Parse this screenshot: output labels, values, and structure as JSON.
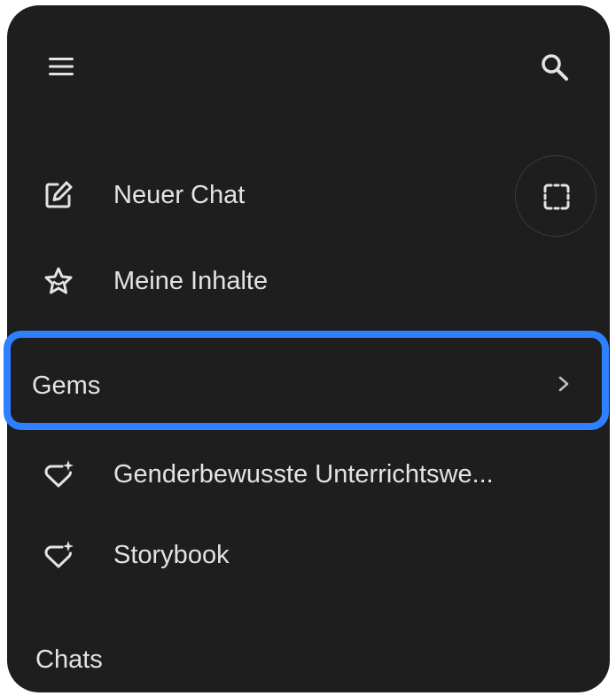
{
  "header": {
    "menu_icon": "hamburger-menu-icon",
    "search_icon": "search-icon"
  },
  "nav": {
    "new_chat": {
      "label": "Neuer Chat",
      "icon": "edit-square-icon"
    },
    "my_content": {
      "label": "Meine Inhalte",
      "icon": "star-content-icon"
    },
    "capture_icon": "screen-capture-icon"
  },
  "gems": {
    "title": "Gems",
    "chevron_icon": "chevron-right-icon",
    "highlight_color": "#2f80ff",
    "items": [
      {
        "label": "Genderbewusste Unterrichtswe...",
        "icon": "gem-sparkle-icon"
      },
      {
        "label": "Storybook",
        "icon": "gem-sparkle-icon"
      }
    ]
  },
  "chats": {
    "title": "Chats"
  },
  "theme": {
    "panel_bg": "#1e1e1e",
    "text": "#e3e3e3"
  }
}
